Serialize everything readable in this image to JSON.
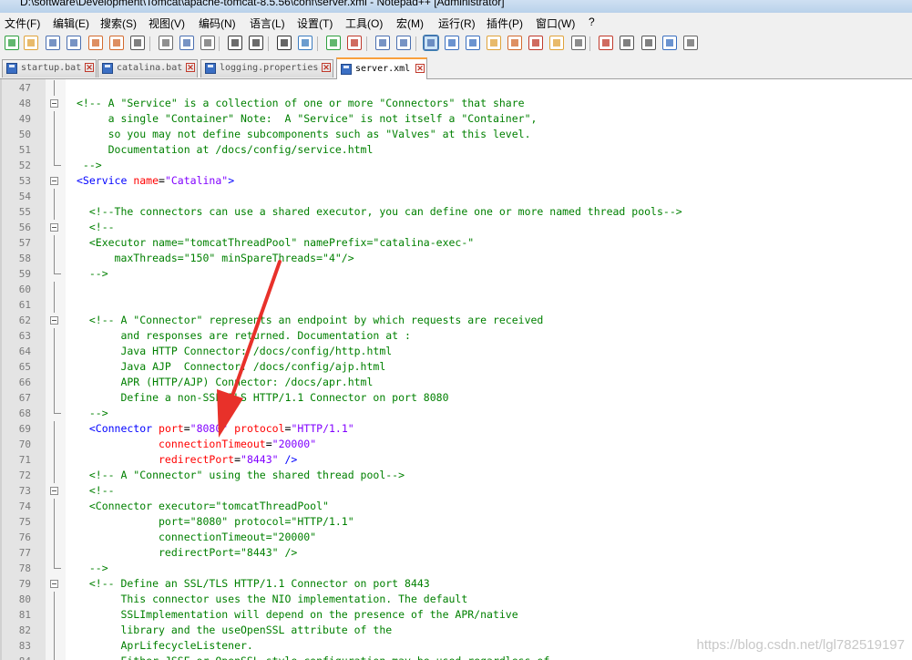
{
  "window": {
    "title": "D:\\software\\Development\\Tomcat\\apache-tomcat-8.5.56\\conf\\server.xml - Notepad++ [Administrator]"
  },
  "menu": [
    "文件(F)",
    "编辑(E)",
    "搜索(S)",
    "视图(V)",
    "编码(N)",
    "语言(L)",
    "设置(T)",
    "工具(O)",
    "宏(M)",
    "运行(R)",
    "插件(P)",
    "窗口(W)",
    "?"
  ],
  "toolbar": [
    "new-file",
    "open-file",
    "save",
    "save-all",
    "close",
    "close-all",
    "print",
    "cut",
    "copy",
    "paste",
    "undo",
    "redo",
    "find",
    "replace",
    "zoom-in",
    "zoom-out",
    "sync-vertical",
    "sync-horizontal",
    "word-wrap",
    "show-all-chars",
    "indent-guide",
    "user-defined-language",
    "document-map",
    "function-list",
    "folder-as-workspace",
    "monitoring",
    "record-macro",
    "stop-recording",
    "playback-macro",
    "run-macro-multiple",
    "save-macro"
  ],
  "tabs": [
    {
      "label": "startup.bat",
      "active": false
    },
    {
      "label": "catalina.bat",
      "active": false
    },
    {
      "label": "logging.properties",
      "active": false
    },
    {
      "label": "server.xml",
      "active": true
    }
  ],
  "colors": {
    "comment": "#008000",
    "tag": "#0000ff",
    "attribute": "#ff0000",
    "value": "#8000ff",
    "active_tab_accent": "#f9a03c",
    "annotation_arrow": "#e8312a"
  },
  "editor": {
    "lines": [
      {
        "n": "47",
        "fold": "line",
        "segs": []
      },
      {
        "n": "48",
        "fold": "box",
        "segs": [
          {
            "t": "<!-- A \"Service\" is a collection of one or more \"Connectors\" that share",
            "k": "c"
          }
        ]
      },
      {
        "n": "49",
        "fold": "line",
        "segs": [
          {
            "t": "     a single \"Container\" Note:  A \"Service\" is not itself a \"Container\",",
            "k": "c"
          }
        ]
      },
      {
        "n": "50",
        "fold": "line",
        "segs": [
          {
            "t": "     so you may not define subcomponents such as \"Valves\" at this level.",
            "k": "c"
          }
        ]
      },
      {
        "n": "51",
        "fold": "line",
        "segs": [
          {
            "t": "     Documentation at /docs/config/service.html",
            "k": "c"
          }
        ]
      },
      {
        "n": "52",
        "fold": "end",
        "segs": [
          {
            "t": " -->",
            "k": "c"
          }
        ]
      },
      {
        "n": "53",
        "fold": "box",
        "segs": [
          {
            "t": "<Service",
            "k": "t"
          },
          {
            "t": " name",
            "k": "a"
          },
          {
            "t": "=",
            "k": "p"
          },
          {
            "t": "\"Catalina\"",
            "k": "v"
          },
          {
            "t": ">",
            "k": "t"
          }
        ]
      },
      {
        "n": "54",
        "fold": "line",
        "segs": []
      },
      {
        "n": "55",
        "fold": "line",
        "segs": [
          {
            "t": "  <!--The connectors can use a shared executor, you can define one or more named thread pools-->",
            "k": "c"
          }
        ]
      },
      {
        "n": "56",
        "fold": "box",
        "segs": [
          {
            "t": "  <!--",
            "k": "c"
          }
        ]
      },
      {
        "n": "57",
        "fold": "line",
        "segs": [
          {
            "t": "  <Executor name=\"tomcatThreadPool\" namePrefix=\"catalina-exec-\"",
            "k": "c"
          }
        ]
      },
      {
        "n": "58",
        "fold": "line",
        "segs": [
          {
            "t": "      maxThreads=\"150\" minSpareThreads=\"4\"/>",
            "k": "c"
          }
        ]
      },
      {
        "n": "59",
        "fold": "end",
        "segs": [
          {
            "t": "  -->",
            "k": "c"
          }
        ]
      },
      {
        "n": "60",
        "fold": "line",
        "segs": []
      },
      {
        "n": "61",
        "fold": "line",
        "segs": []
      },
      {
        "n": "62",
        "fold": "box",
        "segs": [
          {
            "t": "  <!-- A \"Connector\" represents an endpoint by which requests are received",
            "k": "c"
          }
        ]
      },
      {
        "n": "63",
        "fold": "line",
        "segs": [
          {
            "t": "       and responses are returned. Documentation at :",
            "k": "c"
          }
        ]
      },
      {
        "n": "64",
        "fold": "line",
        "segs": [
          {
            "t": "       Java HTTP Connector: /docs/config/http.html",
            "k": "c"
          }
        ]
      },
      {
        "n": "65",
        "fold": "line",
        "segs": [
          {
            "t": "       Java AJP  Connector: /docs/config/ajp.html",
            "k": "c"
          }
        ]
      },
      {
        "n": "66",
        "fold": "line",
        "segs": [
          {
            "t": "       APR (HTTP/AJP) Connector: /docs/apr.html",
            "k": "c"
          }
        ]
      },
      {
        "n": "67",
        "fold": "line",
        "segs": [
          {
            "t": "       Define a non-SSL/TLS HTTP/1.1 Connector on port 8080",
            "k": "c"
          }
        ]
      },
      {
        "n": "68",
        "fold": "end",
        "segs": [
          {
            "t": "  -->",
            "k": "c"
          }
        ]
      },
      {
        "n": "69",
        "fold": "line",
        "segs": [
          {
            "t": "  <Connector",
            "k": "t"
          },
          {
            "t": " port",
            "k": "a"
          },
          {
            "t": "=",
            "k": "p"
          },
          {
            "t": "\"8080\"",
            "k": "v"
          },
          {
            "t": " protocol",
            "k": "a"
          },
          {
            "t": "=",
            "k": "p"
          },
          {
            "t": "\"HTTP/1.1\"",
            "k": "v"
          }
        ]
      },
      {
        "n": "70",
        "fold": "line",
        "segs": [
          {
            "t": "             connectionTimeout",
            "k": "a"
          },
          {
            "t": "=",
            "k": "p"
          },
          {
            "t": "\"20000\"",
            "k": "v"
          }
        ]
      },
      {
        "n": "71",
        "fold": "line",
        "segs": [
          {
            "t": "             redirectPort",
            "k": "a"
          },
          {
            "t": "=",
            "k": "p"
          },
          {
            "t": "\"8443\"",
            "k": "v"
          },
          {
            "t": " />",
            "k": "t"
          }
        ]
      },
      {
        "n": "72",
        "fold": "line",
        "segs": [
          {
            "t": "  <!-- A \"Connector\" using the shared thread pool-->",
            "k": "c"
          }
        ]
      },
      {
        "n": "73",
        "fold": "box",
        "segs": [
          {
            "t": "  <!--",
            "k": "c"
          }
        ]
      },
      {
        "n": "74",
        "fold": "line",
        "segs": [
          {
            "t": "  <Connector executor=\"tomcatThreadPool\"",
            "k": "c"
          }
        ]
      },
      {
        "n": "75",
        "fold": "line",
        "segs": [
          {
            "t": "             port=\"8080\" protocol=\"HTTP/1.1\"",
            "k": "c"
          }
        ]
      },
      {
        "n": "76",
        "fold": "line",
        "segs": [
          {
            "t": "             connectionTimeout=\"20000\"",
            "k": "c"
          }
        ]
      },
      {
        "n": "77",
        "fold": "line",
        "segs": [
          {
            "t": "             redirectPort=\"8443\" />",
            "k": "c"
          }
        ]
      },
      {
        "n": "78",
        "fold": "end",
        "segs": [
          {
            "t": "  -->",
            "k": "c"
          }
        ]
      },
      {
        "n": "79",
        "fold": "box",
        "segs": [
          {
            "t": "  <!-- Define an SSL/TLS HTTP/1.1 Connector on port 8443",
            "k": "c"
          }
        ]
      },
      {
        "n": "80",
        "fold": "line",
        "segs": [
          {
            "t": "       This connector uses the NIO implementation. The default",
            "k": "c"
          }
        ]
      },
      {
        "n": "81",
        "fold": "line",
        "segs": [
          {
            "t": "       SSLImplementation will depend on the presence of the APR/native",
            "k": "c"
          }
        ]
      },
      {
        "n": "82",
        "fold": "line",
        "segs": [
          {
            "t": "       library and the useOpenSSL attribute of the",
            "k": "c"
          }
        ]
      },
      {
        "n": "83",
        "fold": "line",
        "segs": [
          {
            "t": "       AprLifecycleListener.",
            "k": "c"
          }
        ]
      },
      {
        "n": "84",
        "fold": "line",
        "segs": [
          {
            "t": "       Either JSSE or OpenSSL style configuration may be used regardless of",
            "k": "c"
          }
        ]
      }
    ]
  },
  "watermark": "https://blog.csdn.net/lgl782519197"
}
